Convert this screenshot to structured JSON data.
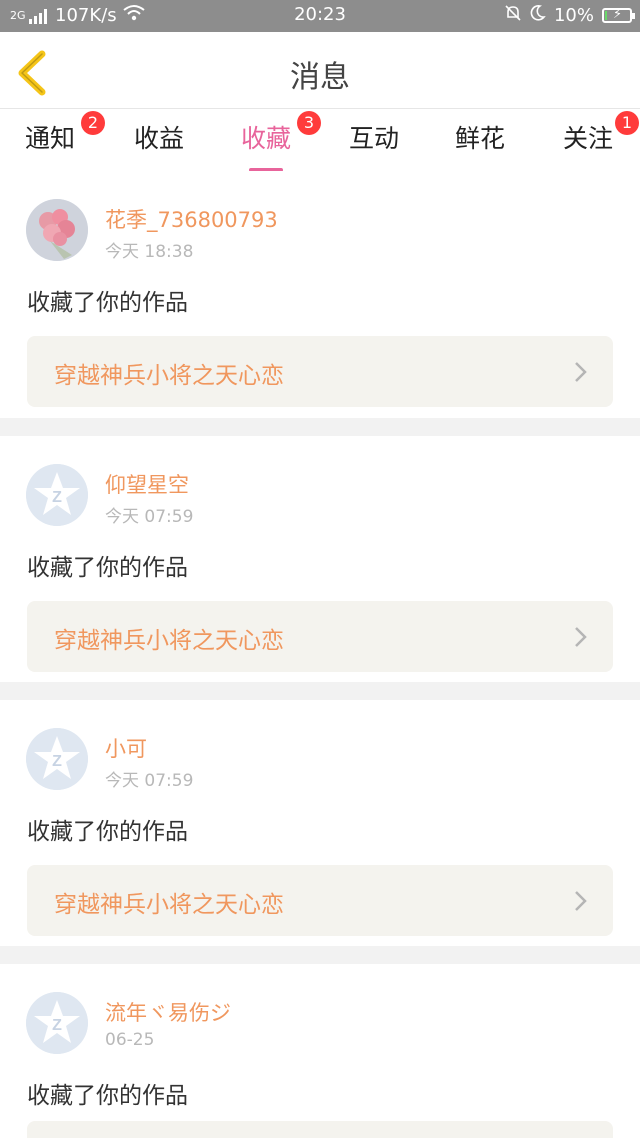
{
  "status_bar": {
    "signal": "2G",
    "speed": "107K/s",
    "time": "20:23",
    "battery": "10%",
    "battery_level": 0.1
  },
  "header": {
    "title": "消息"
  },
  "tabs": [
    {
      "label": "通知",
      "badge": "2",
      "active": false
    },
    {
      "label": "收益",
      "badge": "",
      "active": false
    },
    {
      "label": "收藏",
      "badge": "3",
      "active": true
    },
    {
      "label": "互动",
      "badge": "",
      "active": false
    },
    {
      "label": "鲜花",
      "badge": "",
      "active": false
    },
    {
      "label": "关注",
      "badge": "1",
      "active": false
    }
  ],
  "colors": {
    "accent": "#e8649b",
    "name": "#f0975e",
    "badge": "#ff3b3b",
    "back_icon": "#f5c518"
  },
  "feed": [
    {
      "user": "花季_736800793",
      "time": "今天 18:38",
      "action": "收藏了你的作品",
      "work": "穿越神兵小将之天心恋",
      "avatar": "flower-photo"
    },
    {
      "user": "仰望星空",
      "time": "今天 07:59",
      "action": "收藏了你的作品",
      "work": "穿越神兵小将之天心恋",
      "avatar": "default-star-avatar"
    },
    {
      "user": "小可",
      "time": "今天 07:59",
      "action": "收藏了你的作品",
      "work": "穿越神兵小将之天心恋",
      "avatar": "default-star-avatar"
    },
    {
      "user": "流年ヾ易伤ジ",
      "time": "06-25",
      "action": "收藏了你的作品",
      "work": "",
      "avatar": "default-star-avatar"
    }
  ]
}
